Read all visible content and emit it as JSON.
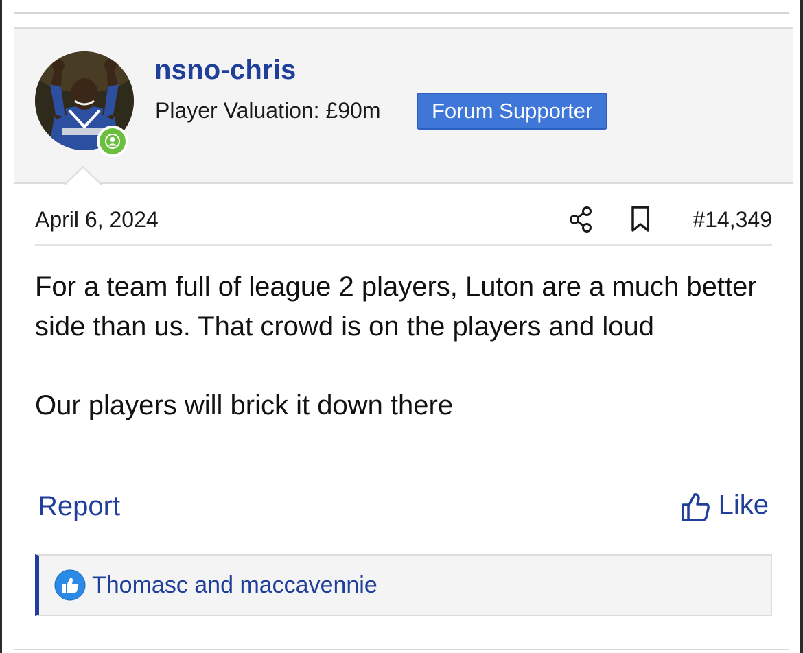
{
  "user": {
    "username": "nsno-chris",
    "valuation": "Player Valuation: £90m",
    "badge": "Forum Supporter"
  },
  "post": {
    "date": "April 6, 2024",
    "number": "#14,349",
    "paragraphs": [
      "For a team full of league 2 players, Luton are a much better side than us. That crowd is on the players and loud",
      "Our players will brick it down there"
    ]
  },
  "actions": {
    "report_label": "Report",
    "like_label": "Like"
  },
  "reactions": {
    "users": "Thomasc and maccavennie"
  },
  "icons": {
    "share": "share-icon",
    "bookmark": "bookmark-icon",
    "like": "thumbs-up-icon",
    "reaction": "like-reaction-icon",
    "status": "user-icon"
  },
  "colors": {
    "link": "#1f3f9a",
    "badge": "#3f77d9",
    "online": "#6abf3f",
    "header_bg": "#f4f4f4"
  }
}
